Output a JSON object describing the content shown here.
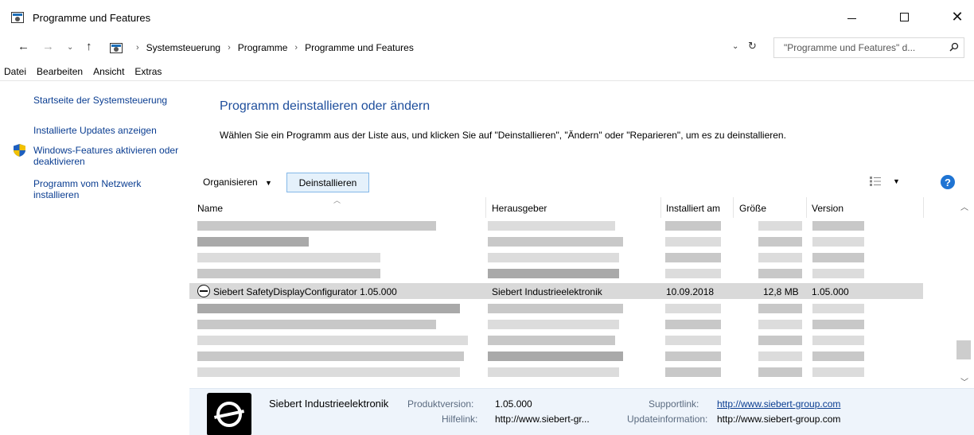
{
  "window": {
    "title": "Programme und Features",
    "icon": "control-panel-icon"
  },
  "address": {
    "crumbs": [
      "Systemsteuerung",
      "Programme",
      "Programme und Features"
    ],
    "search_placeholder": "\"Programme und Features\" d..."
  },
  "menu": [
    "Datei",
    "Bearbeiten",
    "Ansicht",
    "Extras"
  ],
  "sidebar": {
    "links": [
      "Startseite der Systemsteuerung",
      "Installierte Updates anzeigen",
      "Windows-Features aktivieren oder deaktivieren",
      "Programm vom Netzwerk installieren"
    ]
  },
  "main": {
    "title": "Programm deinstallieren oder ändern",
    "description": "Wählen Sie ein Programm aus der Liste aus, und klicken Sie auf \"Deinstallieren\", \"Ändern\" oder \"Reparieren\", um es zu deinstallieren."
  },
  "toolbar": {
    "organize": "Organisieren",
    "uninstall": "Deinstallieren",
    "help": "?"
  },
  "columns": [
    "Name",
    "Herausgeber",
    "Installiert am",
    "Größe",
    "Version"
  ],
  "selected_program": {
    "name": "Siebert SafetyDisplayConfigurator 1.05.000",
    "publisher": "Siebert Industrieelektronik",
    "installed": "10.09.2018",
    "size": "12,8 MB",
    "version": "1.05.000"
  },
  "details": {
    "publisher": "Siebert Industrieelektronik",
    "product_version_label": "Produktversion:",
    "product_version": "1.05.000",
    "support_label": "Supportlink:",
    "support_link": "http://www.siebert-group.com",
    "help_label": "Hilfelink:",
    "help_link": "http://www.siebert-gr...",
    "update_label": "Updateinformation:",
    "update_link": "http://www.siebert-group.com"
  },
  "colors": {
    "link": "#0a3d91",
    "title": "#1e4e9c",
    "selected_row": "#d9d9d9",
    "details_bg": "#eef4fb"
  }
}
